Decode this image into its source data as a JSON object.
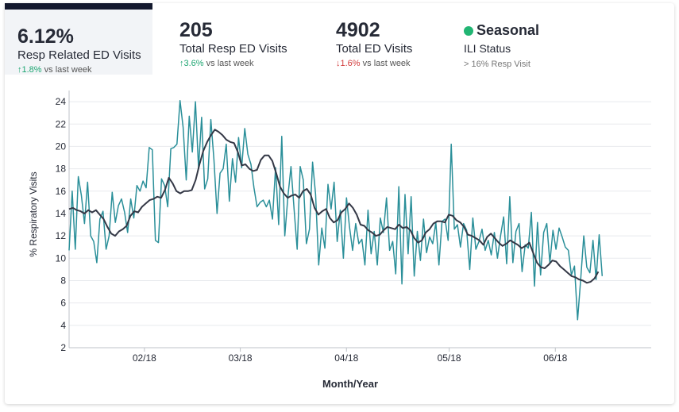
{
  "kpis": [
    {
      "value": "6.12%",
      "label": "Resp Related ED Visits",
      "delta_arrow": "↑",
      "delta_value": "1.8%",
      "delta_suffix": "vs last week",
      "direction": "up"
    },
    {
      "value": "205",
      "label": "Total Resp ED Visits",
      "delta_arrow": "↑",
      "delta_value": "3.6%",
      "delta_suffix": "vs last week",
      "direction": "up"
    },
    {
      "value": "4902",
      "label": "Total ED Visits",
      "delta_arrow": "↓",
      "delta_value": "1.6%",
      "delta_suffix": "vs last week",
      "direction": "down"
    }
  ],
  "status": {
    "title": "Seasonal",
    "label": "ILI Status",
    "note": "> 16% Resp Visit",
    "dot_color": "#21b573"
  },
  "colors": {
    "daily": "#2a8f99",
    "average": "#343846",
    "grid": "#e8eaed",
    "axis": "#bfc3c8"
  },
  "chart_data": {
    "type": "line",
    "xlabel": "Month/Year",
    "ylabel": "% Respiratory Visits",
    "ylim": [
      2,
      25
    ],
    "yticks": [
      2,
      4,
      6,
      8,
      10,
      12,
      14,
      16,
      18,
      20,
      22,
      24
    ],
    "x_tick_labels": [
      "02/18",
      "03/18",
      "04/18",
      "05/18",
      "06/18"
    ],
    "x_tick_days": [
      22,
      50,
      81,
      111,
      142
    ],
    "x_range_days": [
      0,
      170
    ],
    "grid": true,
    "series": [
      {
        "values": [
          10.7,
          16.0,
          10.8,
          17.3,
          15.6,
          13.1,
          16.8,
          12.0,
          11.5,
          9.6,
          13.5,
          14.2,
          10.8,
          12.0,
          15.9,
          13.2,
          14.7,
          15.3,
          14.1,
          12.3,
          15.3,
          13.6,
          16.5,
          16.0,
          16.9,
          16.3,
          19.9,
          19.7,
          11.6,
          11.4,
          17.1,
          16.5,
          14.6,
          19.8,
          19.9,
          20.2,
          24.1,
          21.7,
          17.0,
          22.7,
          19.5,
          24.0,
          18.1,
          22.6,
          16.2,
          17.1,
          22.4,
          18.8,
          14.0,
          17.6,
          18.0,
          20.2,
          15.1,
          18.9,
          16.8,
          20.8,
          18.1,
          21.6,
          19.3,
          18.4,
          16.3,
          14.6,
          15.0,
          15.2,
          14.6,
          15.2,
          13.5,
          18.1,
          13.0,
          20.9,
          12.0,
          15.5,
          18.2,
          14.4,
          10.8,
          18.2,
          17.0,
          11.3,
          12.6,
          18.6,
          15.7,
          9.4,
          12.7,
          10.9,
          16.6,
          14.4,
          16.8,
          11.5,
          14.3,
          10.0,
          15.4,
          12.8,
          10.7,
          13.1,
          11.3,
          11.7,
          9.4,
          14.3,
          10.4,
          12.4,
          9.4,
          13.6,
          12.3,
          15.4,
          10.7,
          11.5,
          8.6,
          16.4,
          7.7,
          15.7,
          10.4,
          15.5,
          8.4,
          12.4,
          9.8,
          13.5,
          10.5,
          11.9,
          11.3,
          13.2,
          9.4,
          13.3,
          13.5,
          11.6,
          20.2,
          12.6,
          13.0,
          11.0,
          13.1,
          12.5,
          9.0,
          13.6,
          10.8,
          11.5,
          12.6,
          10.7,
          11.6,
          10.3,
          12.3,
          10.0,
          12.0,
          13.7,
          9.5,
          15.5,
          9.6,
          12.4,
          13.1,
          8.8,
          11.2,
          10.9,
          14.1,
          7.5,
          13.2,
          8.5,
          12.3,
          13.1,
          9.6,
          12.5,
          10.8,
          12.7,
          11.9,
          11.0,
          10.7,
          8.5,
          9.3,
          4.5,
          8.1,
          12.0,
          9.2,
          8.7,
          11.6,
          8.1,
          12.1,
          8.4
        ],
        "x_start": 0,
        "x_step": 0.9
      },
      {
        "values": [
          14.4,
          14.5,
          14.3,
          14.2,
          14.0,
          14.3,
          14.1,
          14.3,
          13.9,
          13.5,
          12.8,
          12.2,
          12.0,
          12.4,
          12.6,
          12.9,
          13.8,
          14.2,
          14.1,
          14.6,
          14.9,
          15.2,
          15.3,
          15.5,
          15.4,
          16.1,
          17.2,
          16.7,
          16.0,
          15.8,
          16.0,
          16.0,
          16.1,
          17.0,
          18.4,
          19.6,
          20.4,
          21.0,
          21.5,
          21.3,
          21.0,
          20.6,
          20.4,
          20.3,
          19.5,
          18.3,
          18.4,
          18.0,
          17.8,
          17.9,
          18.8,
          19.2,
          19.2,
          18.7,
          17.6,
          16.4,
          15.8,
          15.4,
          15.6,
          15.7,
          15.4,
          16.0,
          16.2,
          15.7,
          14.5,
          13.9,
          14.2,
          14.4,
          13.6,
          13.2,
          13.4,
          14.1,
          14.4,
          14.9,
          14.5,
          13.9,
          13.0,
          12.9,
          12.5,
          12.3,
          12.0,
          12.1,
          12.5,
          12.8,
          12.7,
          12.6,
          13.0,
          12.7,
          12.8,
          12.5,
          11.8,
          11.4,
          11.6,
          12.3,
          12.6,
          13.1,
          13.3,
          13.3,
          13.2,
          13.9,
          13.8,
          13.4,
          13.2,
          12.8,
          12.1,
          12.0,
          11.8,
          11.6,
          11.2,
          11.9,
          12.2,
          11.8,
          11.4,
          11.1,
          11.3,
          11.6,
          11.4,
          11.2,
          10.9,
          11.1,
          11.4,
          10.5,
          9.6,
          9.2,
          9.1,
          9.4,
          9.8,
          9.7,
          9.3,
          9.0,
          8.7,
          8.4,
          8.3,
          8.1,
          8.0,
          7.8,
          7.9,
          8.2,
          8.8
        ],
        "x_start": 0,
        "x_step": 1.12
      }
    ]
  }
}
